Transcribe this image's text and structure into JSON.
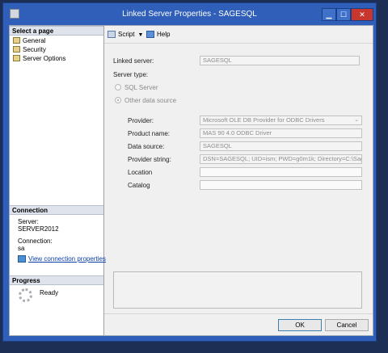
{
  "window": {
    "title": "Linked Server Properties - SAGESQL",
    "controls": {
      "minimize": "▁",
      "maximize": "☐",
      "close": "✕"
    }
  },
  "left": {
    "select_page_header": "Select a page",
    "pages": [
      {
        "label": "General",
        "icon": "page-wrench-icon"
      },
      {
        "label": "Security",
        "icon": "page-wrench-icon"
      },
      {
        "label": "Server Options",
        "icon": "page-wrench-icon"
      }
    ],
    "connection": {
      "header": "Connection",
      "server_label": "Server:",
      "server_value": "SERVER2012",
      "connection_label": "Connection:",
      "connection_value": "sa",
      "view_link": "View connection properties"
    },
    "progress": {
      "header": "Progress",
      "status": "Ready"
    }
  },
  "toolbar": {
    "script_label": "Script",
    "script_dropdown": "▼",
    "help_label": "Help"
  },
  "form": {
    "linked_server_label": "Linked server:",
    "linked_server_value": "SAGESQL",
    "server_type_label": "Server type:",
    "radio_sql_server": "SQL Server",
    "radio_other": "Other data source",
    "selected_server_type": "Other data source",
    "provider_label": "Provider:",
    "provider_value": "Microsoft OLE DB Provider for ODBC Drivers",
    "product_name_label": "Product name:",
    "product_name_value": "MAS 90 4.0 ODBC Driver",
    "data_source_label": "Data source:",
    "data_source_value": "SAGESQL",
    "provider_string_label": "Provider string:",
    "provider_string_value": "DSN=SAGESQL; UID=ism; PWD=g0m1k; Directory=C:\\Sage\\S",
    "location_label": "Location",
    "location_value": "",
    "catalog_label": "Catalog",
    "catalog_value": ""
  },
  "buttons": {
    "ok": "OK",
    "cancel": "Cancel"
  }
}
